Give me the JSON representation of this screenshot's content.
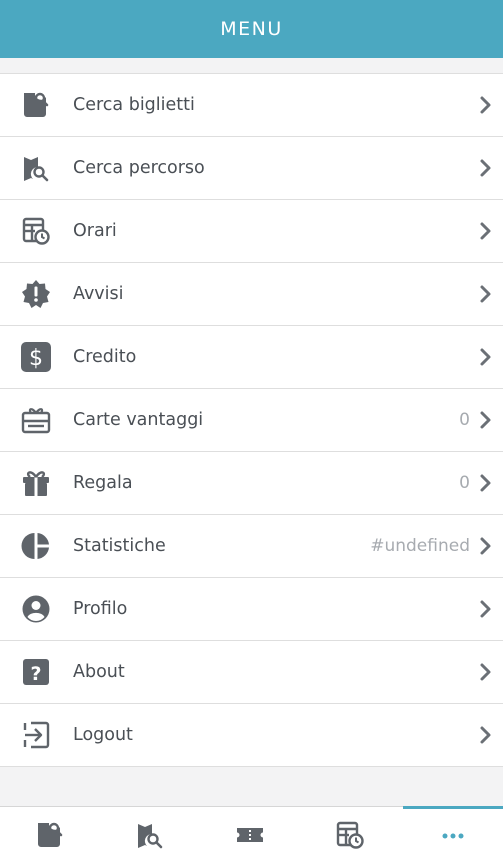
{
  "header": {
    "title": "MENU"
  },
  "menu": {
    "items": [
      {
        "label": "Cerca biglietti",
        "icon": "ticket-search-icon",
        "count": ""
      },
      {
        "label": "Cerca percorso",
        "icon": "map-search-icon",
        "count": ""
      },
      {
        "label": "Orari",
        "icon": "timetable-clock-icon",
        "count": ""
      },
      {
        "label": "Avvisi",
        "icon": "alert-badge-icon",
        "count": ""
      },
      {
        "label": "Credito",
        "icon": "dollar-icon",
        "count": ""
      },
      {
        "label": "Carte vantaggi",
        "icon": "card-gift-icon",
        "count": "0"
      },
      {
        "label": "Regala",
        "icon": "gift-icon",
        "count": "0"
      },
      {
        "label": "Statistiche",
        "icon": "pie-chart-icon",
        "count": "#undefined"
      },
      {
        "label": "Profilo",
        "icon": "profile-icon",
        "count": ""
      },
      {
        "label": "About",
        "icon": "question-icon",
        "count": ""
      },
      {
        "label": "Logout",
        "icon": "logout-icon",
        "count": ""
      }
    ]
  },
  "tabbar": {
    "tabs": [
      {
        "icon": "ticket-search-icon",
        "active": false
      },
      {
        "icon": "map-search-icon",
        "active": false
      },
      {
        "icon": "ticket-icon",
        "active": false
      },
      {
        "icon": "timetable-clock-icon",
        "active": false
      },
      {
        "icon": "more-dots-icon",
        "active": true
      }
    ]
  },
  "colors": {
    "accent": "#4ba8c1",
    "icon": "#5f646a",
    "text": "#4a4f55",
    "muted": "#a7abb0"
  }
}
